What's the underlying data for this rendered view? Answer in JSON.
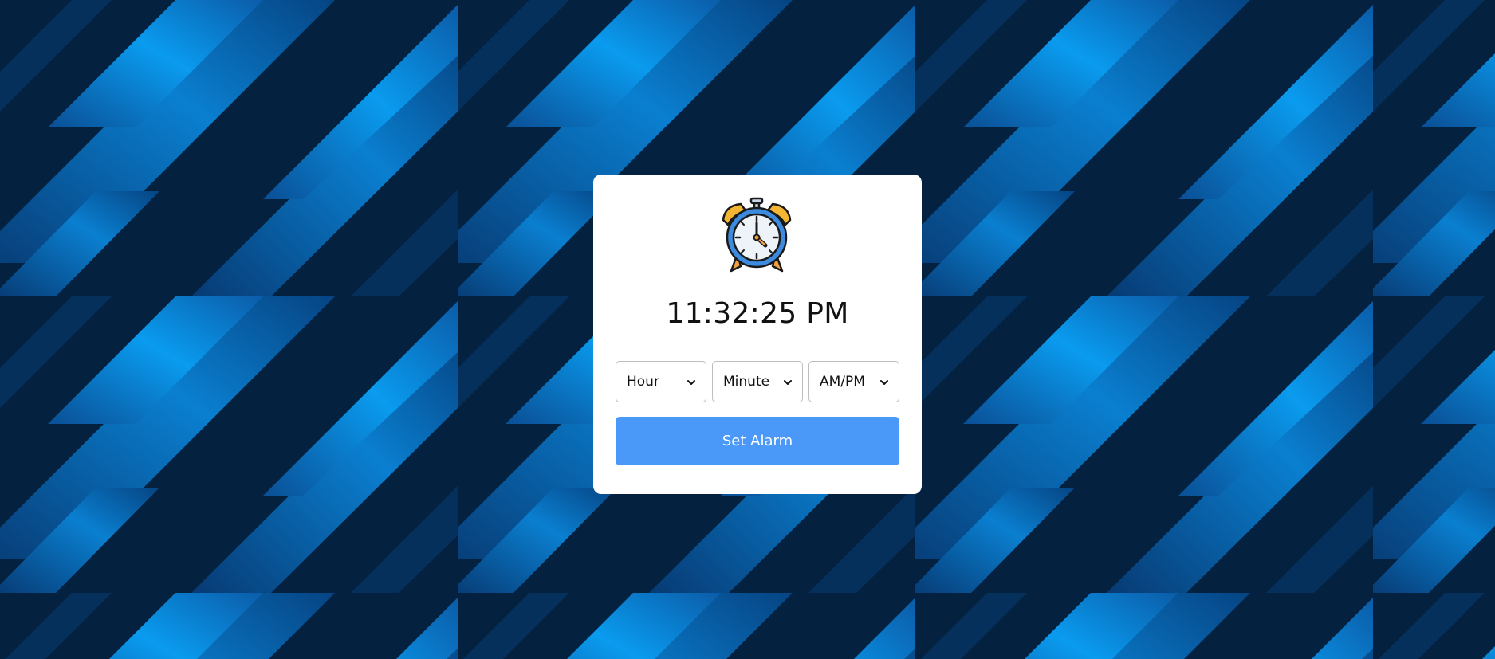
{
  "clock": {
    "icon": "alarm-clock-icon",
    "time": "11:32:25 PM"
  },
  "selects": [
    {
      "label": "Hour",
      "icon": "chevron-down-icon"
    },
    {
      "label": "Minute",
      "icon": "chevron-down-icon"
    },
    {
      "label": "AM/PM",
      "icon": "chevron-down-icon"
    }
  ],
  "button": {
    "label": "Set Alarm"
  },
  "colors": {
    "background_dark": "#04213f",
    "background_light": "#0a9bef",
    "card": "#ffffff",
    "button": "#4a98f7",
    "clock_ring": "#3d8bde",
    "clock_bells": "#f4b632"
  }
}
